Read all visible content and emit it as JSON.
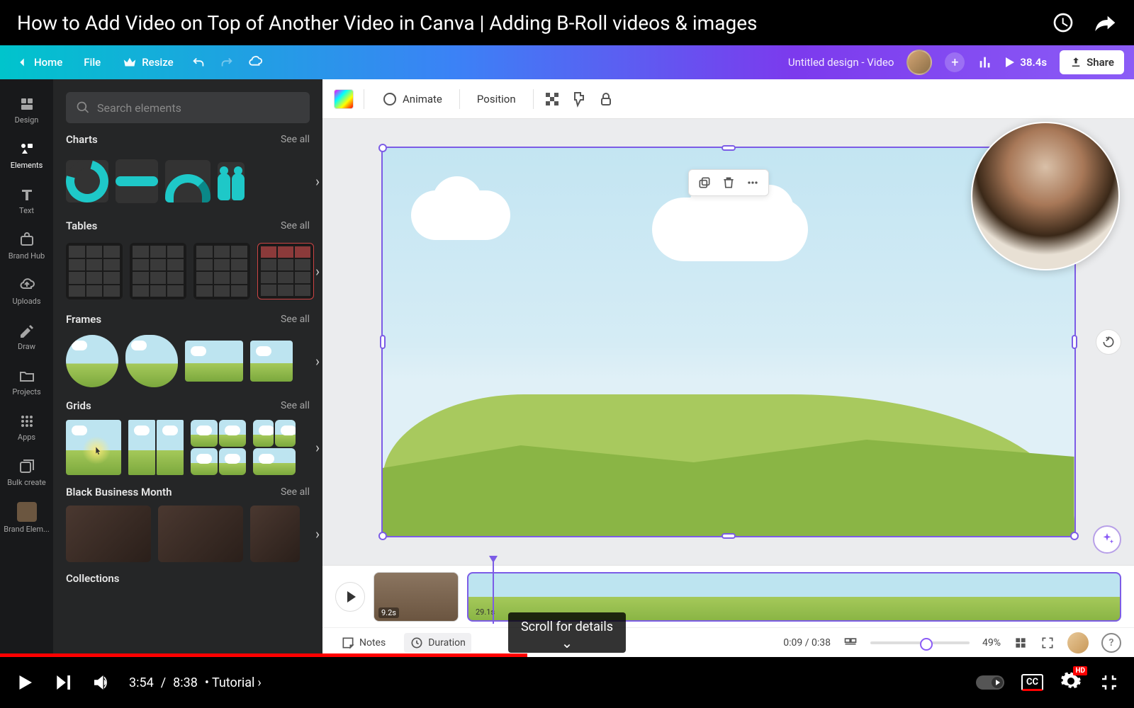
{
  "youtube": {
    "title": "How to Add Video on Top of Another Video in Canva | Adding B-Roll videos & images",
    "scroll_hint": "Scroll for details",
    "time_current": "3:54",
    "time_total": "8:38",
    "chapter": "Tutorial",
    "controls": {
      "cc": "CC",
      "hd": "HD"
    }
  },
  "canva": {
    "header": {
      "home": "Home",
      "file": "File",
      "resize": "Resize",
      "doc_name": "Untitled design - Video",
      "play_time": "38.4s",
      "share": "Share"
    },
    "nav": {
      "design": "Design",
      "elements": "Elements",
      "text": "Text",
      "brand_hub": "Brand Hub",
      "uploads": "Uploads",
      "draw": "Draw",
      "projects": "Projects",
      "apps": "Apps",
      "bulk_create": "Bulk create",
      "brand_elem": "Brand Elem..."
    },
    "panel": {
      "search_placeholder": "Search elements",
      "see_all": "See all",
      "sections": {
        "charts": "Charts",
        "tables": "Tables",
        "frames": "Frames",
        "grids": "Grids",
        "bbm": "Black Business Month",
        "collections": "Collections"
      }
    },
    "toolbar": {
      "animate": "Animate",
      "position": "Position"
    },
    "timeline": {
      "clip1_dur": "9.2s",
      "clip2_dur": "29.1s",
      "notes": "Notes",
      "duration": "Duration",
      "time": "0:09 / 0:38",
      "zoom": "49%"
    }
  }
}
